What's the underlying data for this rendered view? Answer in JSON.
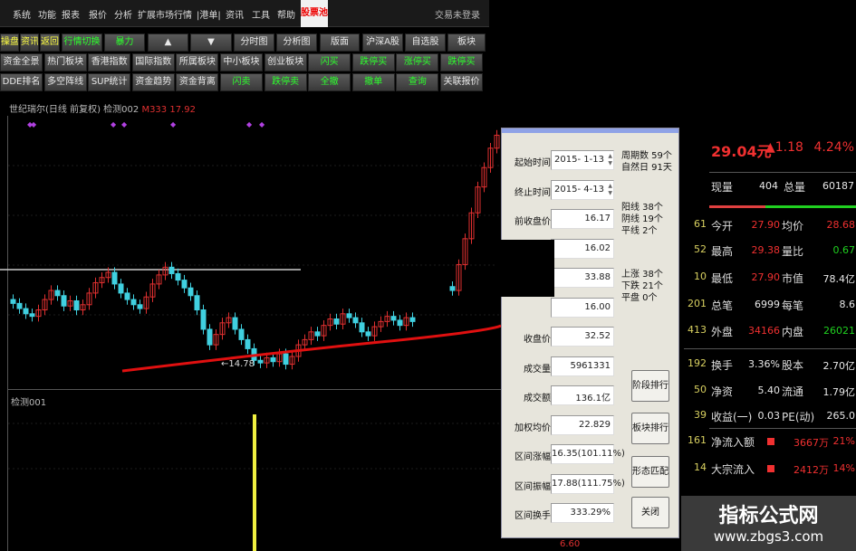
{
  "menubar": {
    "items": [
      "系统",
      "功能",
      "报表",
      "报价",
      "分析",
      "扩展市场行情",
      "|港单|",
      "资讯",
      "工具",
      "帮助"
    ],
    "stock_pool": "股票池",
    "login_status": "交易未登录"
  },
  "toolbar": {
    "row1": [
      {
        "label": "操盘",
        "c": "y"
      },
      {
        "label": "资讯",
        "c": "y"
      },
      {
        "label": "返回",
        "c": "y"
      },
      {
        "label": "行情切换",
        "c": "g"
      },
      {
        "label": "暴力",
        "c": "g"
      },
      {
        "label": "▲",
        "c": ""
      },
      {
        "label": "▼",
        "c": ""
      },
      {
        "label": "分时图",
        "c": ""
      },
      {
        "label": "分析图",
        "c": ""
      },
      {
        "label": "版面",
        "c": ""
      },
      {
        "label": "沪深A股",
        "c": ""
      },
      {
        "label": "自选股",
        "c": ""
      },
      {
        "label": "板块",
        "c": ""
      }
    ],
    "row2": [
      {
        "label": "资金全景",
        "c": ""
      },
      {
        "label": "热门板块",
        "c": ""
      },
      {
        "label": "香港指数",
        "c": ""
      },
      {
        "label": "国际指数",
        "c": ""
      },
      {
        "label": "所属板块",
        "c": ""
      },
      {
        "label": "中小板块",
        "c": ""
      },
      {
        "label": "创业板块",
        "c": ""
      },
      {
        "label": "闪买",
        "c": "g"
      },
      {
        "label": "跌停买",
        "c": "g"
      },
      {
        "label": "涨停买",
        "c": "g"
      },
      {
        "label": "跌停买",
        "c": "g"
      }
    ],
    "row3": [
      {
        "label": "DDE排名",
        "c": ""
      },
      {
        "label": "多空阵线",
        "c": ""
      },
      {
        "label": "SUP统计",
        "c": ""
      },
      {
        "label": "资金趋势",
        "c": ""
      },
      {
        "label": "资金背离",
        "c": ""
      },
      {
        "label": "闪卖",
        "c": "g"
      },
      {
        "label": "跌停卖",
        "c": "g"
      },
      {
        "label": "全撤",
        "c": "g"
      },
      {
        "label": "撤单",
        "c": "g"
      },
      {
        "label": "查询",
        "c": "g"
      },
      {
        "label": "关联报价",
        "c": ""
      }
    ]
  },
  "chart": {
    "title": "世纪瑞尔(日线 前复权) 检测002",
    "indicator": "M333 17.92",
    "low_label": "←14.78",
    "lower_pane_title": "检测001",
    "bottom_value": "6.60",
    "closes": [
      20.0,
      19.6,
      19.2,
      19.0,
      19.5,
      20.3,
      21.0,
      20.6,
      19.8,
      20.2,
      19.5,
      19.9,
      20.8,
      21.6,
      22.0,
      22.4,
      21.5,
      20.8,
      20.3,
      19.9,
      19.6,
      20.5,
      21.5,
      22.2,
      22.8,
      22.3,
      21.8,
      21.2,
      20.6,
      19.5,
      18.0,
      16.8,
      17.6,
      18.5,
      18.9,
      18.0,
      17.2,
      16.5,
      15.6,
      15.4,
      15.8,
      15.5,
      16.1,
      15.3,
      15.9,
      16.8,
      17.2,
      17.8,
      17.5,
      18.3,
      18.8,
      18.4,
      19.2,
      18.9,
      18.5,
      17.8,
      17.5,
      18.2,
      18.6,
      19.0,
      18.7,
      18.3,
      18.9,
      18.6
    ],
    "closes_recent": [
      21.0,
      23.0,
      25.0,
      27.0,
      29.0,
      30.5,
      32.0,
      33.0
    ],
    "colors": {
      "up": "#e03030",
      "down": "#40d0e0",
      "ma": "#e01010",
      "marker": "#b040e0",
      "volume_bar": "#f0f040"
    }
  },
  "dialog": {
    "rows": [
      {
        "label": "起始时间",
        "value": "2015- 1-13",
        "type": "date"
      },
      {
        "label": "终止时间",
        "value": "2015- 4-13",
        "type": "date"
      },
      {
        "label": "前收盘价",
        "value": "16.17"
      },
      {
        "label": "",
        "value": "16.02"
      },
      {
        "label": "",
        "value": "33.88"
      },
      {
        "label": "",
        "value": "16.00"
      },
      {
        "label": "收盘价",
        "value": "32.52"
      },
      {
        "label": "成交量",
        "value": "5961331"
      },
      {
        "label": "成交额",
        "value": "136.1亿"
      },
      {
        "label": "加权均价",
        "value": "22.829"
      },
      {
        "label": "区间涨幅",
        "value": "16.35(101.11%)"
      },
      {
        "label": "区间振幅",
        "value": "17.88(111.75%)"
      },
      {
        "label": "区间换手",
        "value": "333.29%"
      }
    ],
    "stats1": [
      "周期数 59个",
      "自然日 91天"
    ],
    "stats2": [
      "阳线 38个",
      "阴线 19个",
      "平线 2个"
    ],
    "stats3": [
      "上涨 38个",
      "下跌 21个",
      "平盘 0个"
    ],
    "buttons": [
      "阶段排行",
      "板块排行",
      "形态匹配",
      "关闭"
    ]
  },
  "quote": {
    "price": "29.04元",
    "change": "▲1.18",
    "pct": "4.24%",
    "cur_vol_label": "现量",
    "cur_vol": "404",
    "total_vol_label": "总量",
    "total_vol": "60187",
    "rows": [
      {
        "n": "61",
        "l1": "今开",
        "v1": "27.90",
        "c1": "red",
        "l2": "均价",
        "v2": "28.68",
        "c2": "red"
      },
      {
        "n": "52",
        "l1": "最高",
        "v1": "29.38",
        "c1": "red",
        "l2": "量比",
        "v2": "0.67",
        "c2": "grn"
      },
      {
        "n": "10",
        "l1": "最低",
        "v1": "27.90",
        "c1": "red",
        "l2": "市值",
        "v2": "78.4亿",
        "c2": "wht"
      },
      {
        "n": "201",
        "l1": "总笔",
        "v1": "6999",
        "c1": "wht",
        "l2": "每笔",
        "v2": "8.6",
        "c2": "wht"
      },
      {
        "n": "413",
        "l1": "外盘",
        "v1": "34166",
        "c1": "red",
        "l2": "内盘",
        "v2": "26021",
        "c2": "grn"
      },
      {
        "n": "192",
        "l1": "换手",
        "v1": "3.36%",
        "c1": "wht",
        "l2": "股本",
        "v2": "2.70亿",
        "c2": "wht"
      },
      {
        "n": "50",
        "l1": "净资",
        "v1": "5.40",
        "c1": "wht",
        "l2": "流通",
        "v2": "1.79亿",
        "c2": "wht"
      },
      {
        "n": "39",
        "l1": "收益(一)",
        "v1": "0.03",
        "c1": "wht",
        "l2": "PE(动)",
        "v2": "265.0",
        "c2": "wht"
      }
    ],
    "flows": [
      {
        "n": "161",
        "l": "净流入额",
        "v": "3667万",
        "p": "21%"
      },
      {
        "n": "14",
        "l": "大宗流入",
        "v": "2412万",
        "p": "14%"
      }
    ]
  },
  "watermark": {
    "title": "指标公式网",
    "url": "www.zbgs3.com"
  }
}
